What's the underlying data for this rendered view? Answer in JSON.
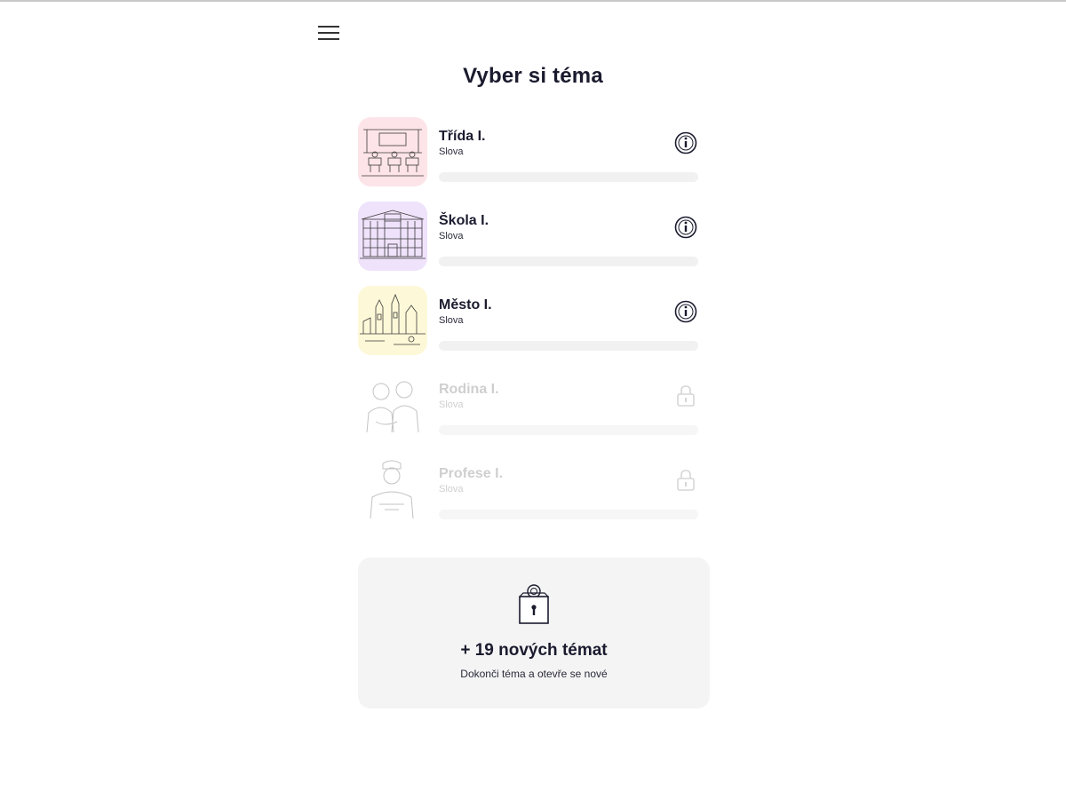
{
  "header": {
    "menu_icon": "hamburger-menu-icon",
    "title": "Vyber si téma"
  },
  "topics": [
    {
      "name": "Třída I.",
      "subtitle": "Slova",
      "locked": false,
      "progress": 0,
      "thumb_bg": "#fde4e8",
      "icon": "info-icon"
    },
    {
      "name": "Škola I.",
      "subtitle": "Slova",
      "locked": false,
      "progress": 0,
      "thumb_bg": "#efe2fb",
      "icon": "info-icon"
    },
    {
      "name": "Město I.",
      "subtitle": "Slova",
      "locked": false,
      "progress": 0,
      "thumb_bg": "#fdf8d8",
      "icon": "info-icon"
    },
    {
      "name": "Rodina I.",
      "subtitle": "Slova",
      "locked": true,
      "progress": 0,
      "thumb_bg": "#ffffff",
      "icon": "lock-icon"
    },
    {
      "name": "Profese I.",
      "subtitle": "Slova",
      "locked": true,
      "progress": 0,
      "thumb_bg": "#ffffff",
      "icon": "lock-icon"
    }
  ],
  "unlock_card": {
    "icon": "padlock-icon",
    "title": "+ 19 nových témat",
    "subtitle": "Dokonči téma a otevře se nové"
  },
  "colors": {
    "text": "#1b1b2f",
    "locked_text": "#cfcfcf",
    "track": "#f1f1f1",
    "card_bg": "#f4f4f4"
  }
}
